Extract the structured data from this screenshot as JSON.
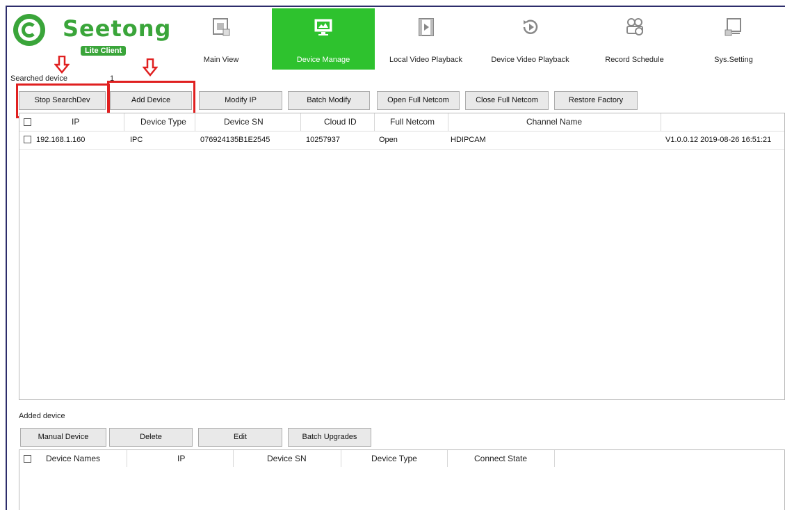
{
  "app": {
    "brand": "Seetong",
    "badge": "Lite Client"
  },
  "nav": [
    {
      "label": "Main View",
      "icon": "film-icon"
    },
    {
      "label": "Device Manage",
      "icon": "monitor-icon"
    },
    {
      "label": "Local Video Playback",
      "icon": "playback-icon"
    },
    {
      "label": "Device Video Playback",
      "icon": "replay-icon"
    },
    {
      "label": "Record Schedule",
      "icon": "schedule-icon"
    },
    {
      "label": "Sys.Setting",
      "icon": "settings-screen-icon"
    }
  ],
  "searched": {
    "label": "Searched device",
    "count": "1",
    "buttons": {
      "stop_search": "Stop SearchDev",
      "add_device": "Add Device",
      "modify_ip": "Modify IP",
      "batch_modify": "Batch Modify",
      "open_full_netcom": "Open Full Netcom",
      "close_full_netcom": "Close Full Netcom",
      "restore_factory": "Restore Factory"
    },
    "columns": {
      "ip": "IP",
      "device_type": "Device Type",
      "device_sn": "Device SN",
      "cloud_id": "Cloud ID",
      "full_netcom": "Full Netcom",
      "channel_name": "Channel Name"
    },
    "rows": [
      {
        "ip": "192.168.1.160",
        "device_type": "IPC",
        "device_sn": "076924135B1E2545",
        "cloud_id": "10257937",
        "full_netcom": "Open",
        "channel_name": "HDIPCAM",
        "version": "V1.0.0.12 2019-08-26 16:51:21"
      }
    ]
  },
  "added": {
    "label": "Added device",
    "buttons": {
      "manual_device": "Manual Device",
      "delete": "Delete",
      "edit": "Edit",
      "batch_upgrades": "Batch Upgrades"
    },
    "columns": {
      "device_names": "Device Names",
      "ip": "IP",
      "device_sn": "Device SN",
      "device_type": "Device Type",
      "connect_state": "Connect State"
    }
  },
  "colors": {
    "accent": "#2ec22e",
    "brand": "#3aa53a",
    "highlight": "#e02020"
  }
}
